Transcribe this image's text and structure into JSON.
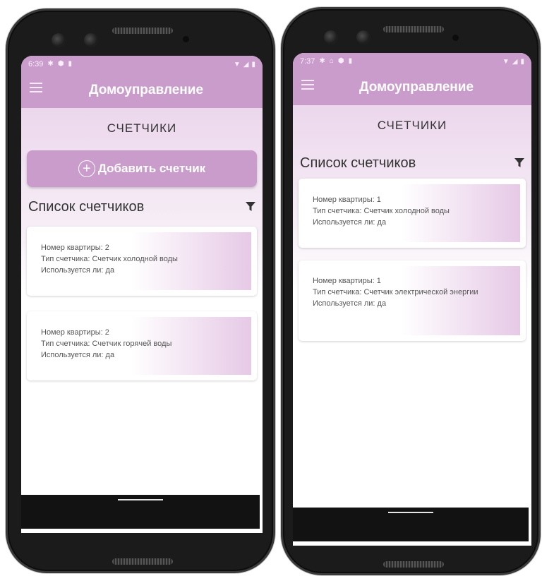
{
  "left": {
    "status": {
      "time": "6:39"
    },
    "app_title": "Домоуправление",
    "section_title": "СЧЕТЧИКИ",
    "add_button_label": "Добавить счетчик",
    "list_title": "Список счетчиков",
    "cards": [
      {
        "apartment": "Номер квартиры: 2",
        "type": "Тип счетчика: Счетчик холодной воды",
        "in_use": "Используется ли: да"
      },
      {
        "apartment": "Номер квартиры: 2",
        "type": "Тип счетчика: Счетчик горячей воды",
        "in_use": "Используется ли: да"
      }
    ]
  },
  "right": {
    "status": {
      "time": "7:37"
    },
    "app_title": "Домоуправление",
    "section_title": "СЧЕТЧИКИ",
    "list_title": "Список счетчиков",
    "cards": [
      {
        "apartment": "Номер квартиры: 1",
        "type": "Тип счетчика: Счетчик холодной воды",
        "in_use": "Используется ли: да"
      },
      {
        "apartment": "Номер квартиры: 1",
        "type": "Тип счетчика: Счетчик электрической энергии",
        "in_use": "Используется ли: да"
      }
    ]
  },
  "colors": {
    "accent": "#c99ccb",
    "background_gradient_top": "#ecd7ec"
  }
}
